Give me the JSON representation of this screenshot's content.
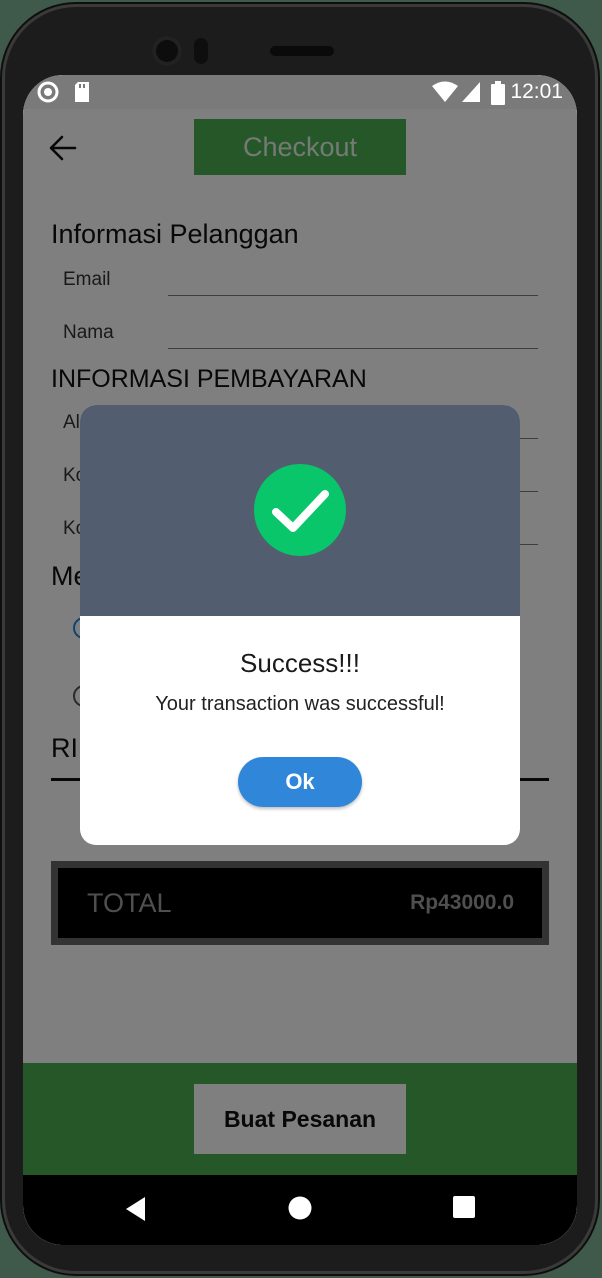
{
  "status_bar": {
    "time": "12:01"
  },
  "header": {
    "title": "Checkout"
  },
  "customer_info": {
    "title": "Informasi Pelanggan",
    "email_label": "Email",
    "name_label": "Nama"
  },
  "payment_info": {
    "title": "INFORMASI PEMBAYARAN",
    "field_1_label_partial": "Al",
    "field_2_label_partial": "Ko",
    "field_3_label_partial": "Ko"
  },
  "method_section": {
    "title_partial": "Me"
  },
  "details_section": {
    "title_partial": "RI"
  },
  "total": {
    "label": "TOTAL",
    "value": "Rp43000.0"
  },
  "order_button": {
    "label": "Buat Pesanan"
  },
  "dialog": {
    "title": "Success!!!",
    "message": "Your transaction was successful!",
    "ok_label": "Ok"
  },
  "colors": {
    "green": "#4caf50",
    "dialog_header": "#525e6f",
    "success_green": "#09c66b",
    "ok_blue": "#3086d9"
  }
}
